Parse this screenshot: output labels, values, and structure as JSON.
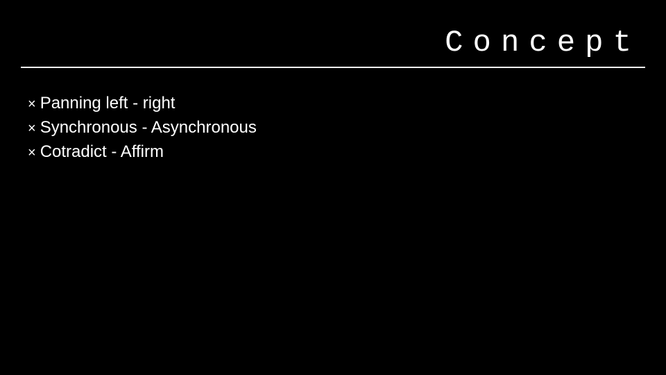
{
  "title": "Concept",
  "bullets": [
    {
      "marker": "×",
      "text": "Panning left - right"
    },
    {
      "marker": "×",
      "text": "Synchronous - Asynchronous"
    },
    {
      "marker": "×",
      "text": "Cotradict - Affirm"
    }
  ]
}
